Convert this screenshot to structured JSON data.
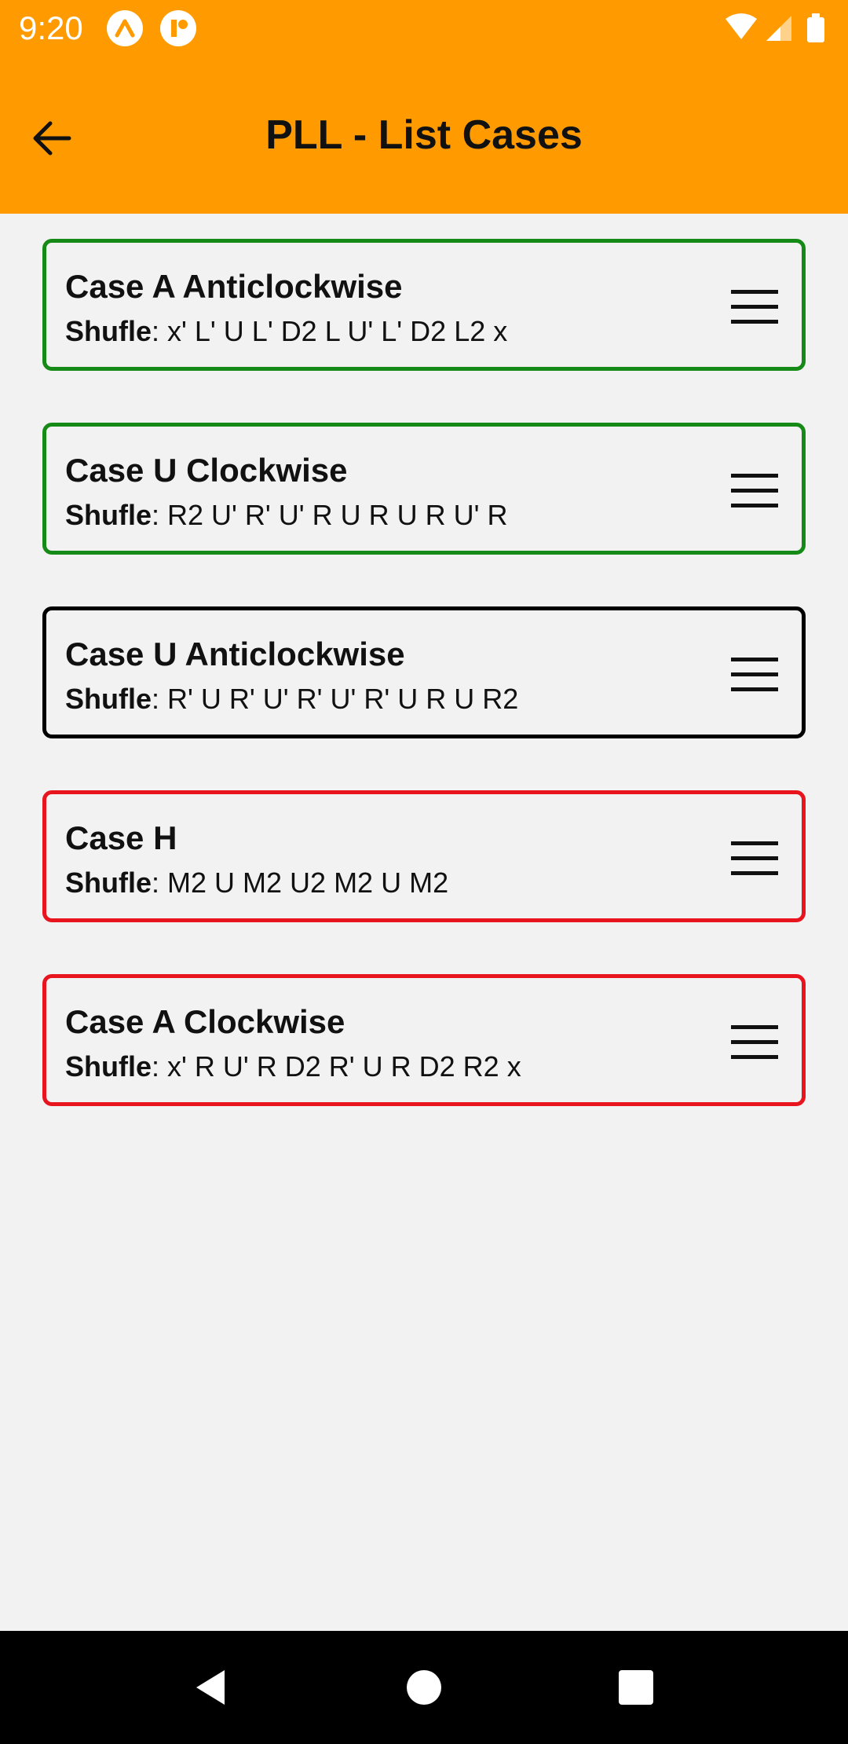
{
  "status_bar": {
    "time": "9:20",
    "icons": [
      "expo-icon",
      "app-icon",
      "wifi-icon",
      "signal-icon",
      "battery-icon"
    ]
  },
  "app_bar": {
    "title": "PLL - List Cases",
    "back_icon": "arrow-left-icon"
  },
  "colors": {
    "primary": "#ff9b00",
    "green": "#168a16",
    "red": "#e8141e",
    "black": "#000000",
    "background": "#f2f2f2"
  },
  "cases": [
    {
      "name": "Case A Anticlockwise",
      "shuffle_label": "Shufle",
      "shuffle": ": x' L' U L' D2 L U' L' D2 L2 x",
      "status": "green"
    },
    {
      "name": "Case U Clockwise",
      "shuffle_label": "Shufle",
      "shuffle": ": R2 U' R' U' R U R U R U' R",
      "status": "green"
    },
    {
      "name": "Case U Anticlockwise",
      "shuffle_label": "Shufle",
      "shuffle": ": R' U R' U' R' U' R' U R U R2",
      "status": "black"
    },
    {
      "name": "Case H",
      "shuffle_label": "Shufle",
      "shuffle": ": M2 U M2 U2 M2 U M2",
      "status": "red"
    },
    {
      "name": "Case A Clockwise",
      "shuffle_label": "Shufle",
      "shuffle": ": x' R U' R D2 R' U R D2 R2 x",
      "status": "red"
    }
  ],
  "nav_bar": {
    "buttons": [
      "back-triangle-icon",
      "home-circle-icon",
      "recents-square-icon"
    ]
  }
}
